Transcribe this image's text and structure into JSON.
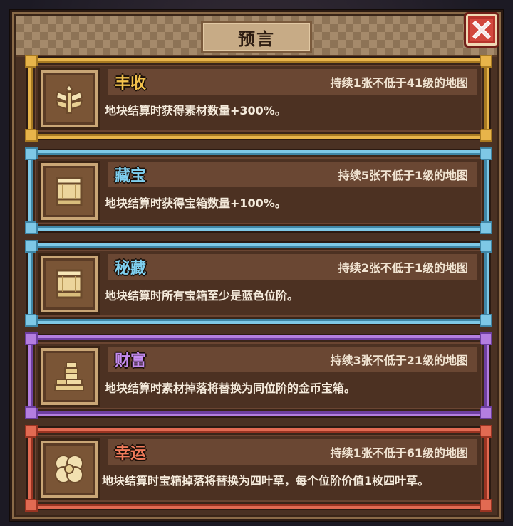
{
  "dialog": {
    "title": "预言",
    "close_icon": "close-x-icon"
  },
  "cards": [
    {
      "name": "丰收",
      "condition": "持续1张不低于41级的地图",
      "description": "地块结算时获得素材数量+300%。",
      "icon": "wheat-icon",
      "frame_color": "#e8b44a",
      "name_color": "#f3c24c"
    },
    {
      "name": "藏宝",
      "condition": "持续5张不低于1级的地图",
      "description": "地块结算时获得宝箱数量+100%。",
      "icon": "treasure-chest-icon",
      "frame_color": "#7ec8e6",
      "name_color": "#7fd0f0"
    },
    {
      "name": "秘藏",
      "condition": "持续2张不低于1级的地图",
      "description": "地块结算时所有宝箱至少是蓝色位阶。",
      "icon": "treasure-chest-icon",
      "frame_color": "#7ec8e6",
      "name_color": "#7fd0f0"
    },
    {
      "name": "财富",
      "condition": "持续3张不低于21级的地图",
      "description": "地块结算时素材掉落将替换为同位阶的金币宝箱。",
      "icon": "coin-stack-icon",
      "frame_color": "#b47ee0",
      "name_color": "#c58cf0"
    },
    {
      "name": "幸运",
      "condition": "持续1张不低于61级的地图",
      "description": "地块结算时宝箱掉落将替换为四叶草，每个位阶价值1枚四叶草。",
      "icon": "four-leaf-clover-icon",
      "frame_color": "#e26a52",
      "name_color": "#f07a5a"
    }
  ]
}
